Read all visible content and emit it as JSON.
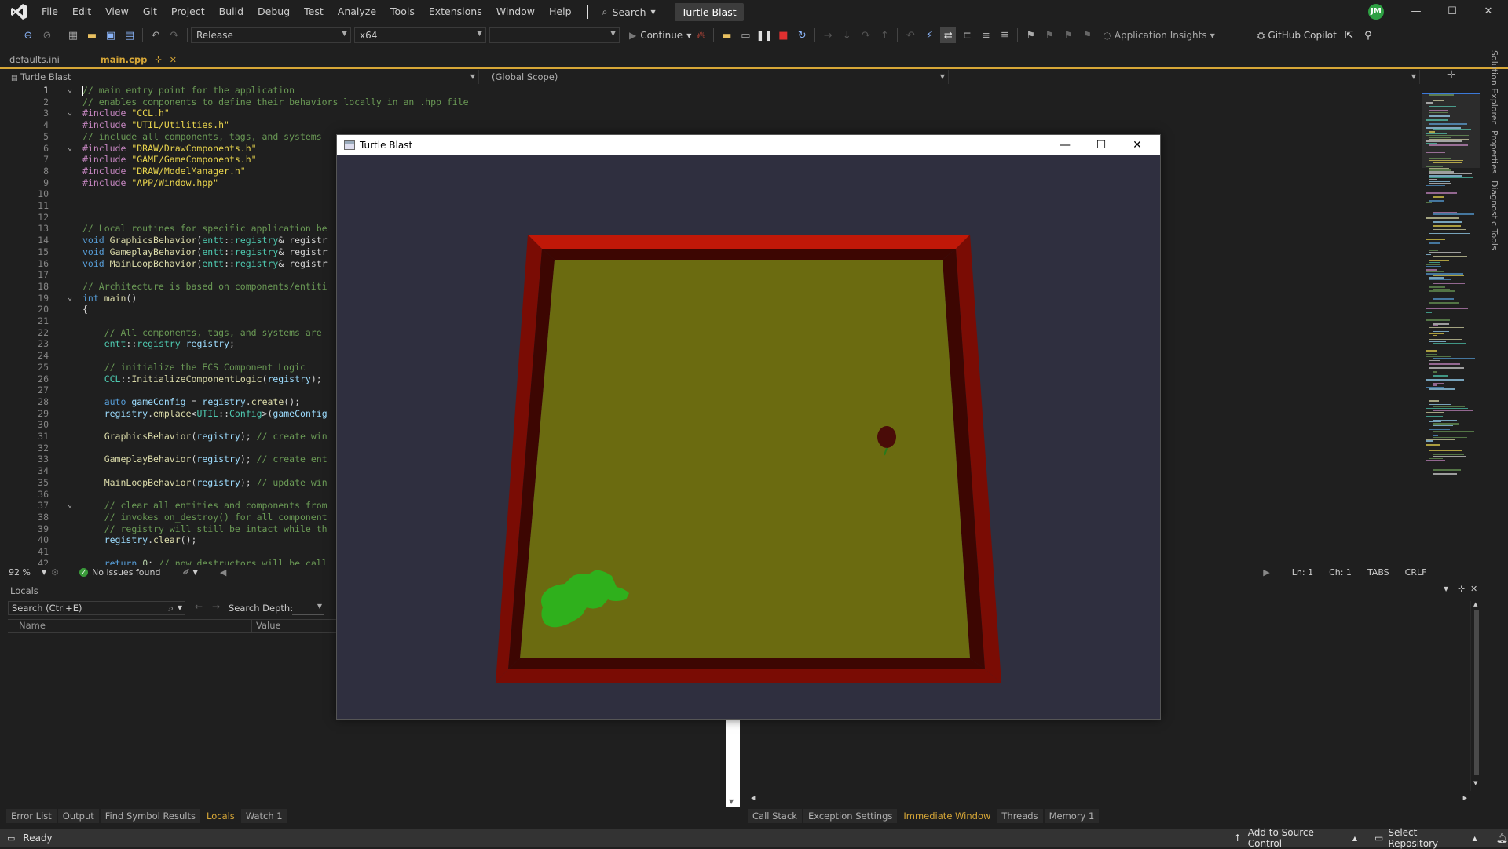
{
  "menubar": {
    "items": [
      "File",
      "Edit",
      "View",
      "Git",
      "Project",
      "Build",
      "Debug",
      "Test",
      "Analyze",
      "Tools",
      "Extensions",
      "Window",
      "Help"
    ],
    "search_label": "Search",
    "solution_title": "Turtle Blast",
    "avatar_initials": "JM"
  },
  "toolbar": {
    "configuration": "Release",
    "platform": "x64",
    "startup_item": "",
    "continue_label": "Continue",
    "insights_label": "Application Insights",
    "copilot_label": "GitHub Copilot"
  },
  "doc_tabs": [
    {
      "label": "defaults.ini",
      "active": false
    },
    {
      "label": "main.cpp",
      "active": true
    }
  ],
  "navbar": {
    "project": "Turtle Blast",
    "scope": "(Global Scope)",
    "member": ""
  },
  "code_lines": [
    {
      "n": "1",
      "html": "<span class='cm'>// main entry point for the application</span>"
    },
    {
      "n": "2",
      "html": "<span class='cm'>// enables components to define their behaviors locally in an .hpp file</span>"
    },
    {
      "n": "3",
      "html": "<span class='pp'>#include</span> <span class='str'>\"CCL.h\"</span>"
    },
    {
      "n": "4",
      "html": "<span class='pp'>#include</span> <span class='str'>\"UTIL/Utilities.h\"</span>"
    },
    {
      "n": "5",
      "html": "<span class='cm'>// include all components, tags, and systems</span>"
    },
    {
      "n": "6",
      "html": "<span class='pp'>#include</span> <span class='str'>\"DRAW/DrawComponents.h\"</span>"
    },
    {
      "n": "7",
      "html": "<span class='pp'>#include</span> <span class='str'>\"GAME/GameComponents.h\"</span>"
    },
    {
      "n": "8",
      "html": "<span class='pp'>#include</span> <span class='str'>\"DRAW/ModelManager.h\"</span>"
    },
    {
      "n": "9",
      "html": "<span class='pp'>#include</span> <span class='str'>\"APP/Window.hpp\"</span>"
    },
    {
      "n": "10",
      "html": ""
    },
    {
      "n": "11",
      "html": ""
    },
    {
      "n": "12",
      "html": ""
    },
    {
      "n": "13",
      "html": "<span class='cm'>// Local routines for specific application be</span>"
    },
    {
      "n": "14",
      "html": "<span class='kw'>void</span> <span class='fn'>GraphicsBehavior</span><span class='pl'>(</span><span class='ty'>entt</span><span class='pl'>::</span><span class='ty'>registry</span><span class='pl'>&amp; registr</span>"
    },
    {
      "n": "15",
      "html": "<span class='kw'>void</span> <span class='fn'>GameplayBehavior</span><span class='pl'>(</span><span class='ty'>entt</span><span class='pl'>::</span><span class='ty'>registry</span><span class='pl'>&amp; registr</span>"
    },
    {
      "n": "16",
      "html": "<span class='kw'>void</span> <span class='fn'>MainLoopBehavior</span><span class='pl'>(</span><span class='ty'>entt</span><span class='pl'>::</span><span class='ty'>registry</span><span class='pl'>&amp; registr</span>"
    },
    {
      "n": "17",
      "html": ""
    },
    {
      "n": "18",
      "html": "<span class='cm'>// Architecture is based on components/entiti</span>"
    },
    {
      "n": "19",
      "html": "<span class='kw'>int</span> <span class='fn'>main</span><span class='pl'>()</span>"
    },
    {
      "n": "20",
      "html": "<span class='pl'>{</span>"
    },
    {
      "n": "21",
      "html": ""
    },
    {
      "n": "22",
      "html": "    <span class='cm'>// All components, tags, and systems are</span>"
    },
    {
      "n": "23",
      "html": "    <span class='ty'>entt</span><span class='pl'>::</span><span class='ty'>registry</span> <span class='var'>registry</span><span class='pl'>;</span>"
    },
    {
      "n": "24",
      "html": ""
    },
    {
      "n": "25",
      "html": "    <span class='cm'>// initialize the ECS Component Logic</span>"
    },
    {
      "n": "26",
      "html": "    <span class='ty'>CCL</span><span class='pl'>::</span><span class='fn'>InitializeComponentLogic</span><span class='pl'>(</span><span class='var'>registry</span><span class='pl'>);</span>"
    },
    {
      "n": "27",
      "html": ""
    },
    {
      "n": "28",
      "html": "    <span class='kw'>auto</span> <span class='var'>gameConfig</span> <span class='pl'>=</span> <span class='var'>registry</span><span class='pl'>.</span><span class='fn'>create</span><span class='pl'>();</span>"
    },
    {
      "n": "29",
      "html": "    <span class='var'>registry</span><span class='pl'>.</span><span class='fn'>emplace</span><span class='pl'>&lt;</span><span class='ty'>UTIL</span><span class='pl'>::</span><span class='ty'>Config</span><span class='pl'>&gt;(</span><span class='var'>gameConfig</span>"
    },
    {
      "n": "30",
      "html": ""
    },
    {
      "n": "31",
      "html": "    <span class='fn'>GraphicsBehavior</span><span class='pl'>(</span><span class='var'>registry</span><span class='pl'>);</span> <span class='cm'>// create win</span>"
    },
    {
      "n": "32",
      "html": ""
    },
    {
      "n": "33",
      "html": "    <span class='fn'>GameplayBehavior</span><span class='pl'>(</span><span class='var'>registry</span><span class='pl'>);</span> <span class='cm'>// create ent</span>"
    },
    {
      "n": "34",
      "html": ""
    },
    {
      "n": "35",
      "html": "    <span class='fn'>MainLoopBehavior</span><span class='pl'>(</span><span class='var'>registry</span><span class='pl'>);</span> <span class='cm'>// update win</span>"
    },
    {
      "n": "36",
      "html": ""
    },
    {
      "n": "37",
      "html": "    <span class='cm'>// clear all entities and components from</span>"
    },
    {
      "n": "38",
      "html": "    <span class='cm'>// invokes on_destroy() for all component</span>"
    },
    {
      "n": "39",
      "html": "    <span class='cm'>// registry will still be intact while th</span>"
    },
    {
      "n": "40",
      "html": "    <span class='var'>registry</span><span class='pl'>.</span><span class='fn'>clear</span><span class='pl'>();</span>"
    },
    {
      "n": "41",
      "html": ""
    },
    {
      "n": "42",
      "html": "    <span class='kw'>return</span> <span class='nm'>0</span><span class='pl'>;</span> <span class='cm'>// now destructors will be call</span>"
    }
  ],
  "fold_lines": [
    "1",
    "3",
    "6",
    "19",
    "37"
  ],
  "editor_status": {
    "zoom": "92 %",
    "issues": "No issues found",
    "line": "Ln: 1",
    "col": "Ch: 1",
    "indent": "TABS",
    "eol": "CRLF"
  },
  "locals": {
    "title": "Locals",
    "search_placeholder": "Search (Ctrl+E)",
    "search_depth_label": "Search Depth:",
    "col_name": "Name",
    "col_value": "Value"
  },
  "bottom_tabs_left": [
    "Error List",
    "Output",
    "Find Symbol Results",
    "Locals",
    "Watch 1"
  ],
  "bottom_tabs_left_active": "Locals",
  "bottom_tabs_right": [
    "Call Stack",
    "Exception Settings",
    "Immediate Window",
    "Threads",
    "Memory 1"
  ],
  "bottom_tabs_right_active": "Immediate Window",
  "right_side_tabs": [
    "Solution Explorer",
    "Properties",
    "Diagnostic Tools"
  ],
  "statusbar": {
    "ready": "Ready",
    "source_control": "Add to Source Control",
    "repository": "Select Repository"
  },
  "game_window": {
    "title": "Turtle Blast",
    "colors": {
      "floor": "#6b6b10",
      "wall_top": "#c01808",
      "wall_side": "#7a0c04",
      "wall_inner": "#3d0602",
      "turtle": "#2fb01c",
      "enemy": "#4a0c08",
      "background": "#2f2f3f"
    }
  },
  "colors": {
    "accent": "#d7a737",
    "status_bar": "#333333",
    "editor_bg": "#1f1f1f"
  }
}
